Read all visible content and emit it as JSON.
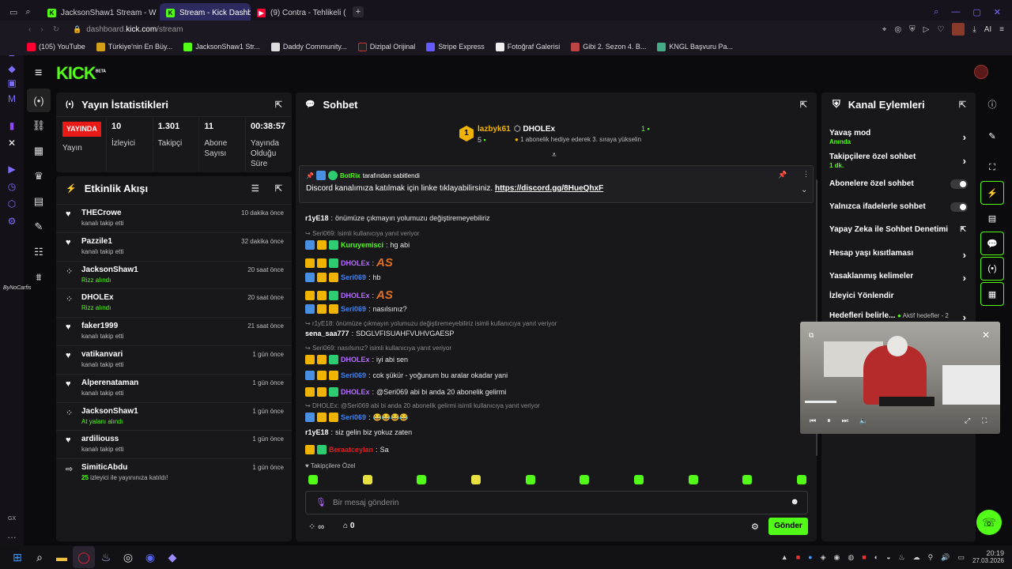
{
  "browser": {
    "tabs": [
      {
        "label": "JacksonShaw1 Stream - W",
        "color": "#53fc18",
        "active": false
      },
      {
        "label": "Stream - Kick Dashboard",
        "color": "#53fc18",
        "active": true
      },
      {
        "label": "(9) Contra - Tehlikeli (",
        "color": "#ff0033",
        "active": false
      }
    ],
    "url_prefix": "dashboard.",
    "url_host": "kick.com",
    "url_path": "/stream",
    "ai_label": "AI",
    "bookmarks": [
      "(105) YouTube",
      "Türkiye'nin En Büy...",
      "JacksonShaw1 Str...",
      "Daddy Community...",
      "Dizipal Orijinal",
      "Stripe Express",
      "Fotoğraf Galerisi",
      "Gibi 2. Sezon 4. B...",
      "KNGL Başvuru Pa..."
    ]
  },
  "brand": {
    "logo": "KICK",
    "beta": "BETA",
    "color": "#53fc18"
  },
  "left_nav_icons": [
    "broadcast-icon",
    "link-icon",
    "analytics-icon",
    "trophy-icon",
    "video-icon",
    "wrench-icon",
    "users-icon",
    "queue-icon"
  ],
  "stats": {
    "title": "Yayın İstatistikleri",
    "live_badge": "YAYINDA",
    "live_label": "Yayın",
    "items": [
      {
        "value": "10",
        "label": "İzleyici"
      },
      {
        "value": "1.301",
        "label": "Takipçi"
      },
      {
        "value": "11",
        "label": "Abone Sayısı"
      },
      {
        "value": "00:38:57",
        "label": "Yayında Olduğu Süre"
      }
    ]
  },
  "events": {
    "title": "Etkinlik Akışı",
    "items": [
      {
        "name": "THECrowe",
        "sub": "kanalı takip etti",
        "time": "10 dakika önce",
        "icon": "heart-icon",
        "green": false
      },
      {
        "name": "Pazzile1",
        "sub": "kanalı takip etti",
        "time": "32 dakika önce",
        "icon": "heart-icon",
        "green": false
      },
      {
        "name": "JacksonShaw1",
        "sub": "Rizz alındı",
        "time": "20 saat önce",
        "icon": "reward-icon",
        "green": true
      },
      {
        "name": "DHOLEx",
        "sub": "Rizz alındı",
        "time": "20 saat önce",
        "icon": "reward-icon",
        "green": true
      },
      {
        "name": "faker1999",
        "sub": "kanalı takip etti",
        "time": "21 saat önce",
        "icon": "heart-icon",
        "green": false
      },
      {
        "name": "vatikanvari",
        "sub": "kanalı takip etti",
        "time": "1 gün önce",
        "icon": "heart-icon",
        "green": false
      },
      {
        "name": "Alperenataman",
        "sub": "kanalı takip etti",
        "time": "1 gün önce",
        "icon": "heart-icon",
        "green": false
      },
      {
        "name": "JacksonShaw1",
        "sub": "At yalanı alındı",
        "time": "1 gün önce",
        "icon": "reward-icon",
        "green": true
      },
      {
        "name": "ardiliouss",
        "sub": "kanalı takip etti",
        "time": "1 gün önce",
        "icon": "heart-icon",
        "green": false
      },
      {
        "name": "SimiticAbdu",
        "sub_prefix": "25",
        "sub": " izleyici ile yayınınıza katıldı!",
        "time": "1 gün önce",
        "icon": "raid-icon",
        "green": false
      }
    ]
  },
  "chat": {
    "title": "Sohbet",
    "leader1": {
      "name": "lazbyk61",
      "count": "5"
    },
    "leader2": {
      "name": "DHOLEx",
      "count": "1",
      "sub": "1 abonelik hediye ederek 3. sıraya yükselin"
    },
    "pinned": {
      "by_name": "BotRix",
      "by_suffix": "tarafından sabitlendi",
      "text": "Discord kanalımıza katılmak için linke tıklayabilirsiniz.",
      "link": "https://discord.gg/8HueQhxF"
    },
    "messages": [
      {
        "type": "msg",
        "user": "r1yE18",
        "color": "#ffffff",
        "text": "önümüze çıkmayın yolumuzu değiştiremeyebiliriz",
        "badges": []
      },
      {
        "type": "reply",
        "text": "Seri069:  isimli kullanıcıya yanıt veriyor"
      },
      {
        "type": "msg",
        "user": "Kuruyemisci",
        "color": "#53fc18",
        "text": "hg abi",
        "badges": [
          "#4a90e2",
          "#f0b400",
          "#2ecc71"
        ]
      },
      {
        "type": "msg",
        "user": "DHOLEx",
        "color": "#b36bff",
        "text": "AS",
        "emote": true,
        "badges": [
          "#f0b400",
          "#f0b400",
          "#2ecc71"
        ]
      },
      {
        "type": "msg",
        "user": "Seri069",
        "color": "#3b82f6",
        "text": "hb",
        "badges": [
          "#4a90e2",
          "#f0b400",
          "#f0b400"
        ]
      },
      {
        "type": "msg",
        "user": "DHOLEx",
        "color": "#b36bff",
        "text": "AS",
        "emote": true,
        "badges": [
          "#f0b400",
          "#f0b400",
          "#2ecc71"
        ]
      },
      {
        "type": "msg",
        "user": "Seri069",
        "color": "#3b82f6",
        "text": "nasılsınız?",
        "badges": [
          "#4a90e2",
          "#f0b400",
          "#f0b400"
        ]
      },
      {
        "type": "reply",
        "text": "r1yE18: önümüze çıkmayın yolumuzu değiştiremeyebiliriz isimli kullanıcıya yanıt veriyor"
      },
      {
        "type": "msg",
        "user": "sena_saa777",
        "color": "#ffffff",
        "text": "SDGLVFISUAHFVUHVGAESP",
        "badges": []
      },
      {
        "type": "reply",
        "text": "Seri069: nasılsınız? isimli kullanıcıya yanıt veriyor"
      },
      {
        "type": "msg",
        "user": "DHOLEx",
        "color": "#b36bff",
        "text": "iyi abi sen",
        "badges": [
          "#f0b400",
          "#f0b400",
          "#2ecc71"
        ]
      },
      {
        "type": "msg",
        "user": "Seri069",
        "color": "#3b82f6",
        "text": "cok şükür - yoğunum bu aralar okadar yani",
        "badges": [
          "#4a90e2",
          "#f0b400",
          "#f0b400"
        ]
      },
      {
        "type": "msg",
        "user": "DHOLEx",
        "color": "#b36bff",
        "text": "@Seri069 abi bi anda 20 abonelik gelirmi",
        "badges": [
          "#f0b400",
          "#f0b400",
          "#2ecc71"
        ]
      },
      {
        "type": "reply",
        "text": "DHOLEx: @Seri069 abi bi anda 20 abonelik gelirmi isimli kullanıcıya yanıt veriyor"
      },
      {
        "type": "msg",
        "user": "Seri069",
        "color": "#3b82f6",
        "text": "😂😂😂😂",
        "badges": [
          "#4a90e2",
          "#f0b400",
          "#f0b400"
        ]
      },
      {
        "type": "msg",
        "user": "r1yE18",
        "color": "#ffffff",
        "text": "siz gelin biz yokuz zaten",
        "badges": []
      },
      {
        "type": "msg",
        "user": "Beraatceylan",
        "color": "#e02020",
        "text": "Sa",
        "badges": [
          "#f0b400",
          "#2ecc71"
        ]
      }
    ],
    "followers_only_label": "Takipçilere Özel",
    "input_placeholder": "Bir mesaj gönderin",
    "points": "∞",
    "store_count": "0",
    "send_label": "Gönder"
  },
  "channel_actions": {
    "title": "Kanal Eylemleri",
    "items": [
      {
        "label": "Yavaş mod",
        "sub": "Anında",
        "kind": "chevron"
      },
      {
        "label": "Takipçilere özel sohbet",
        "sub": "1 dk.",
        "kind": "chevron"
      },
      {
        "label": "Abonelere özel sohbet",
        "kind": "toggle"
      },
      {
        "label": "Yalnızca ifadelerle sohbet",
        "kind": "toggle"
      },
      {
        "label": "Yapay Zeka ile Sohbet Denetimi",
        "kind": "external"
      },
      {
        "label": "Hesap yaşı kısıtlaması",
        "kind": "chevron"
      },
      {
        "label": "Yasaklanmış kelimeler",
        "kind": "chevron"
      },
      {
        "label": "İzleyici Yönlendir",
        "kind": "none"
      },
      {
        "label": "Hedefleri belirle...",
        "extra": "Aktif hedefler - 2",
        "kind": "chevron"
      }
    ]
  },
  "taskbar": {
    "time": "20:19",
    "date": "27.03.2026"
  }
}
